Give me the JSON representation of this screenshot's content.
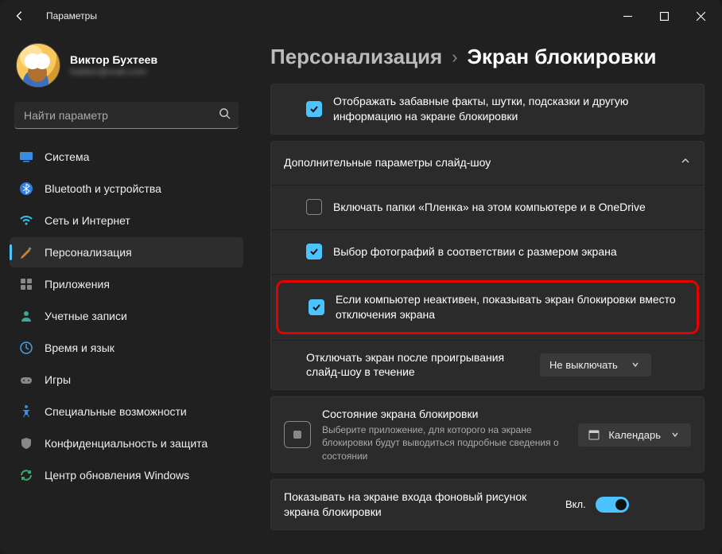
{
  "app_title": "Параметры",
  "profile": {
    "name": "Виктор Бухтеев",
    "email": "hidden@mail.com"
  },
  "search": {
    "placeholder": "Найти параметр"
  },
  "nav": [
    {
      "label": "Система"
    },
    {
      "label": "Bluetooth и устройства"
    },
    {
      "label": "Сеть и Интернет"
    },
    {
      "label": "Персонализация"
    },
    {
      "label": "Приложения"
    },
    {
      "label": "Учетные записи"
    },
    {
      "label": "Время и язык"
    },
    {
      "label": "Игры"
    },
    {
      "label": "Специальные возможности"
    },
    {
      "label": "Конфиденциальность и защита"
    },
    {
      "label": "Центр обновления Windows"
    }
  ],
  "breadcrumb": {
    "parent": "Персонализация",
    "sep": "›",
    "current": "Экран блокировки"
  },
  "options": {
    "fun_facts": "Отображать забавные факты, шутки, подсказки и другую информацию на экране блокировки",
    "slideshow_header": "Дополнительные параметры слайд-шоу",
    "include_camera_roll": "Включать папки «Пленка» на этом компьютере и в OneDrive",
    "fit_to_screen": "Выбор фотографий в соответствии с размером экрана",
    "idle_lockscreen": "Если компьютер неактивен, показывать экран блокировки вместо отключения экрана",
    "turn_off_label": "Отключать экран после проигрывания слайд-шоу в течение",
    "turn_off_value": "Не выключать",
    "status_title": "Состояние экрана блокировки",
    "status_desc": "Выберите приложение, для которого на экране блокировки будут выводиться подробные сведения о состоянии",
    "status_value": "Календарь",
    "signin_bg": "Показывать на экране входа фоновый рисунок экрана блокировки",
    "toggle_on": "Вкл."
  }
}
